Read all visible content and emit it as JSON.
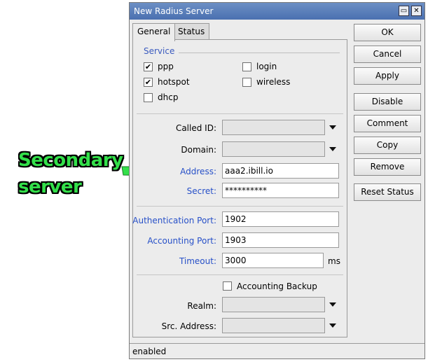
{
  "window": {
    "title": "New Radius Server"
  },
  "tabs": [
    {
      "label": "General"
    },
    {
      "label": "Status"
    }
  ],
  "service": {
    "label": "Service",
    "options": [
      {
        "label": "ppp",
        "checked": true
      },
      {
        "label": "hotspot",
        "checked": true
      },
      {
        "label": "dhcp",
        "checked": false
      },
      {
        "label": "login",
        "checked": false
      },
      {
        "label": "wireless",
        "checked": false
      }
    ]
  },
  "fields": {
    "called_id": {
      "label": "Called ID:",
      "value": ""
    },
    "domain": {
      "label": "Domain:",
      "value": ""
    },
    "address": {
      "label": "Address:",
      "value": "aaa2.ibill.io"
    },
    "secret": {
      "label": "Secret:",
      "value": "**********"
    },
    "auth_port": {
      "label": "Authentication Port:",
      "value": "1902"
    },
    "acct_port": {
      "label": "Accounting Port:",
      "value": "1903"
    },
    "timeout": {
      "label": "Timeout:",
      "value": "3000",
      "unit": "ms"
    },
    "accounting_backup": {
      "label": "Accounting Backup",
      "checked": false
    },
    "realm": {
      "label": "Realm:",
      "value": ""
    },
    "src_address": {
      "label": "Src. Address:",
      "value": ""
    }
  },
  "buttons": {
    "ok": "OK",
    "cancel": "Cancel",
    "apply": "Apply",
    "disable": "Disable",
    "comment": "Comment",
    "copy": "Copy",
    "remove": "Remove",
    "reset_status": "Reset Status"
  },
  "status_bar": "enabled",
  "annotation": {
    "line1": "Secondary",
    "line2": "server",
    "color": "#33e04a"
  }
}
